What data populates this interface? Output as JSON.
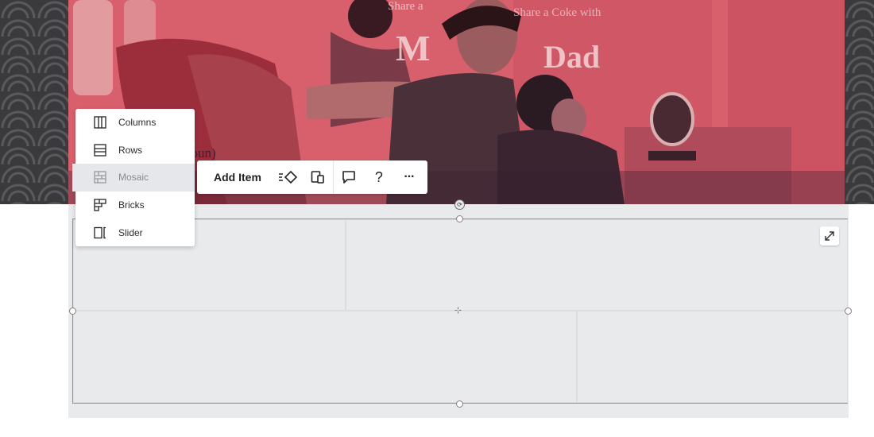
{
  "hero": {
    "share_text_1": "Share a",
    "share_text_2": "Share a Coke with",
    "big_m": "M",
    "big_dad": "Dad",
    "noun_text": "noun)"
  },
  "toolbar": {
    "add_item_label": "Add Item",
    "icons": [
      "layout-switch-icon",
      "device-view-icon",
      "comment-icon",
      "help-icon",
      "more-icon"
    ],
    "help_glyph": "?",
    "more_glyph": "···"
  },
  "layout_menu": {
    "items": [
      {
        "label": "Columns",
        "icon": "columns-icon",
        "active": false
      },
      {
        "label": "Rows",
        "icon": "rows-icon",
        "active": false
      },
      {
        "label": "Mosaic",
        "icon": "mosaic-icon",
        "active": true
      },
      {
        "label": "Bricks",
        "icon": "bricks-icon",
        "active": false
      },
      {
        "label": "Slider",
        "icon": "slider-icon",
        "active": false
      }
    ]
  },
  "colors": {
    "hero_tint": "#d9646f",
    "selection_border": "#b8818f",
    "gallery_bg": "#e9eaec"
  }
}
